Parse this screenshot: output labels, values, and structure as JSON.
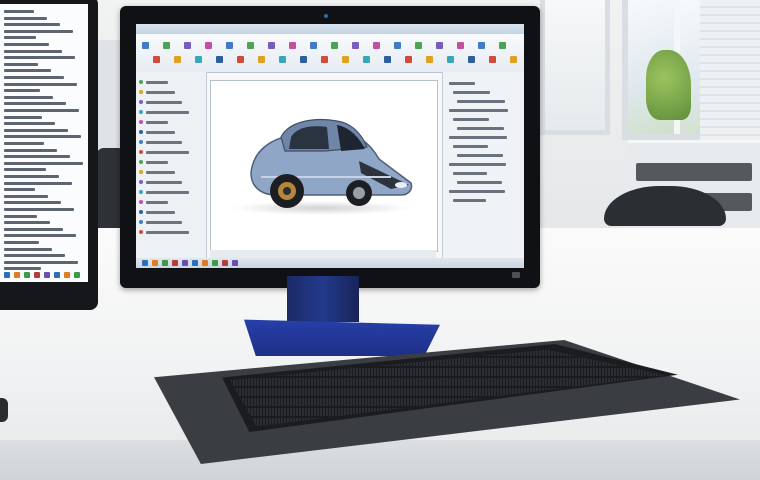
{
  "scene": {
    "description_tags": [
      "office-room",
      "desk",
      "secondary-monitor",
      "main-monitor",
      "cad-application",
      "car-3d-model",
      "monitor-stand",
      "keyboard",
      "desk-mat",
      "window",
      "office-chair"
    ]
  },
  "colors": {
    "stand": "#233a8c",
    "monitor_bezel": "#0f1114",
    "car_body": "#8fa6c7",
    "desk": "#f1f2f3",
    "mat": "#3a3d41"
  },
  "monitor": {
    "brand_text": "",
    "app": {
      "ribbon_tool_colors": [
        "#3e7cc3",
        "#d24a3a",
        "#4aa356",
        "#e0a020",
        "#7a5bbf",
        "#3aa6b9",
        "#c24fa0",
        "#2f5e9e"
      ],
      "taskbar_item_colors": [
        "#2c6fb5",
        "#e07b22",
        "#3d9a4a",
        "#b33d3d",
        "#6b4fb0"
      ]
    }
  }
}
